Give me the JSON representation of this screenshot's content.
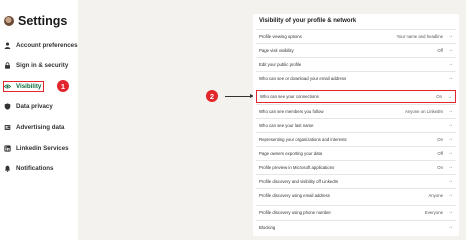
{
  "sidebar": {
    "title": "Settings",
    "items": [
      {
        "label": "Account preferences",
        "icon": "person-icon"
      },
      {
        "label": "Sign in & security",
        "icon": "lock-icon"
      },
      {
        "label": "Visibility",
        "icon": "eye-icon"
      },
      {
        "label": "Data privacy",
        "icon": "shield-icon"
      },
      {
        "label": "Advertising data",
        "icon": "newspaper-icon"
      },
      {
        "label": "Linkedin Services",
        "icon": "linkedin-icon"
      },
      {
        "label": "Notifications",
        "icon": "bell-icon"
      }
    ]
  },
  "annotations": {
    "badge1": "1",
    "badge2": "2"
  },
  "panel": {
    "title": "Visibility of your profile & network",
    "rows": [
      {
        "label": "Profile viewing options",
        "value": "Your name and headline"
      },
      {
        "label": "Page visit visibility",
        "value": "Off"
      },
      {
        "label": "Edit your public profile",
        "value": ""
      },
      {
        "label": "Who can see or download your email address",
        "value": ""
      },
      {
        "label": "Who can see your connections",
        "value": "On"
      },
      {
        "label": "Who can see members you follow",
        "value": "Anyone on LinkedIn"
      },
      {
        "label": "Who can see your last name",
        "value": ""
      },
      {
        "label": "Representing your organizations and interests",
        "value": "On"
      },
      {
        "label": "Page owners exporting your data",
        "value": "Off"
      },
      {
        "label": "Profile preview in Microsoft applications",
        "value": "On"
      },
      {
        "label": "Profile discovery and visibility off LinkedIn",
        "value": ""
      },
      {
        "label": "Profile discovery using email address",
        "value": "Anyone"
      },
      {
        "label": "Profile discovery using phone number",
        "value": "Everyone"
      },
      {
        "label": "Blocking",
        "value": ""
      }
    ]
  },
  "colors": {
    "accent_red": "#e3262b",
    "active_green": "#0a6b3d",
    "background": "#f3f2ee"
  }
}
